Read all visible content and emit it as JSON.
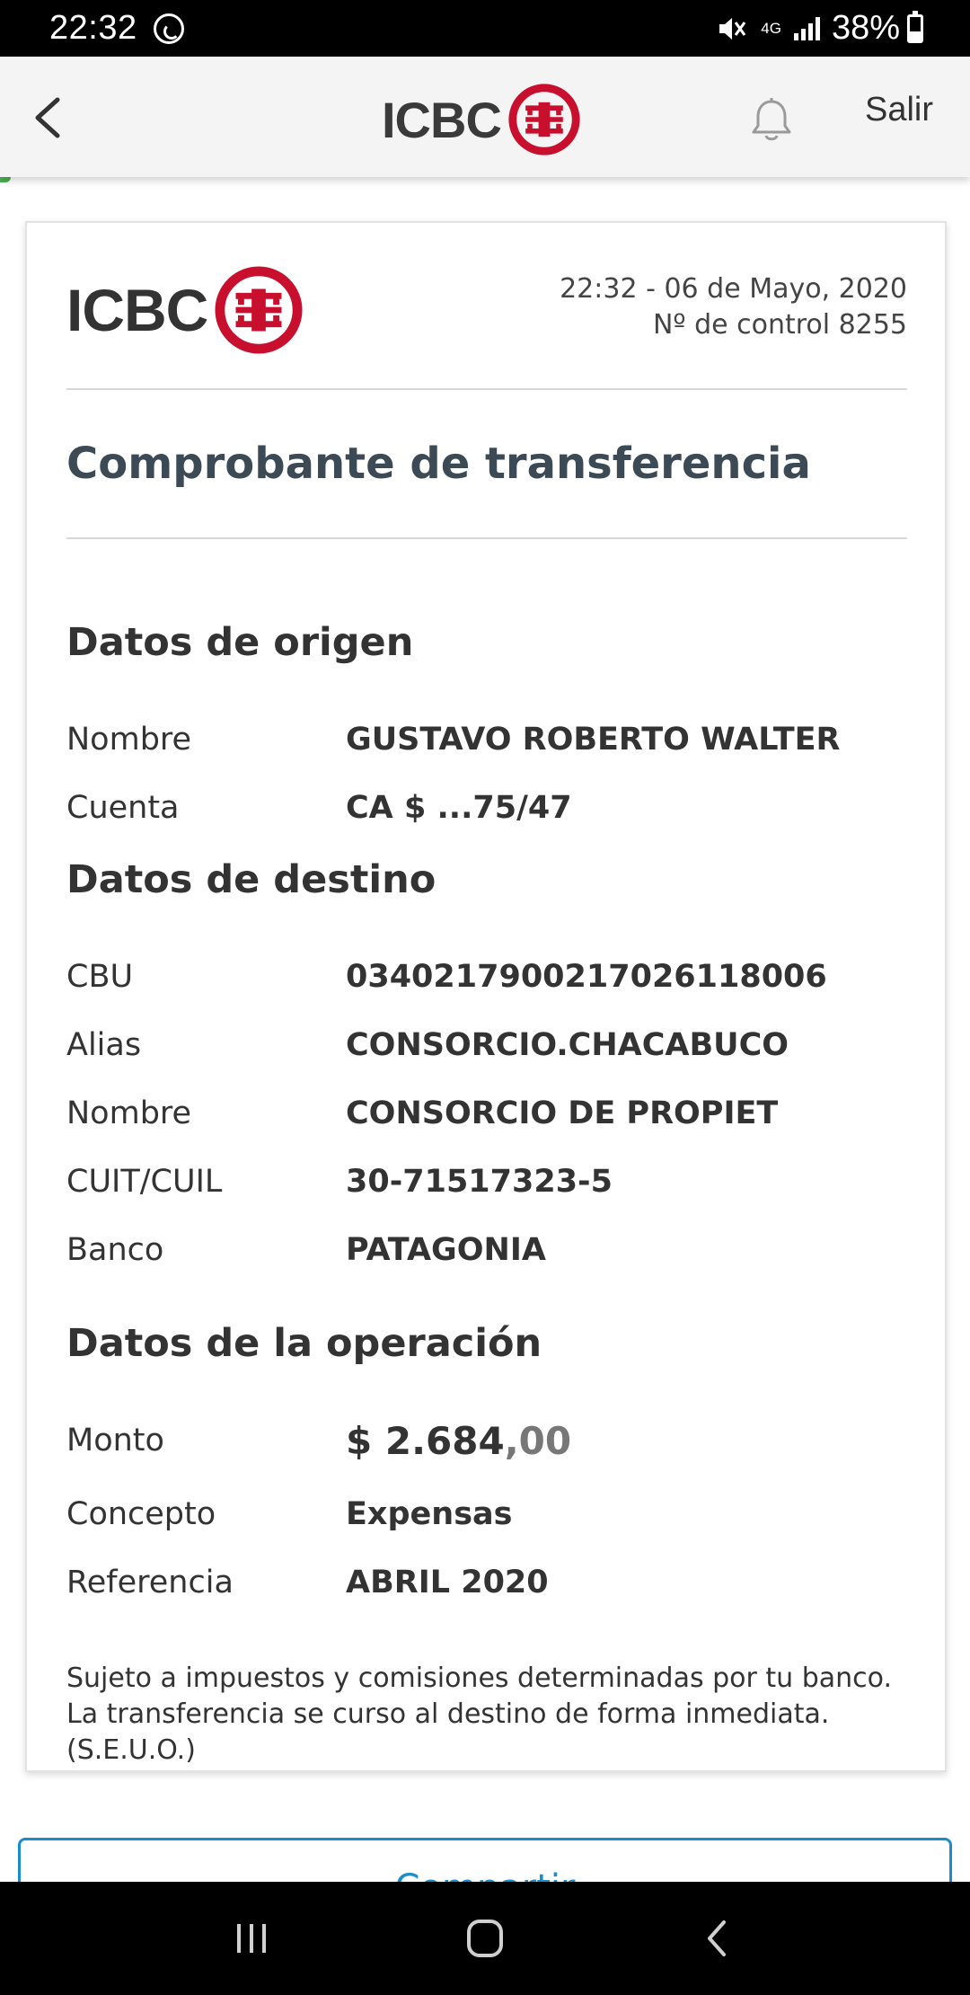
{
  "status_bar": {
    "time": "22:32",
    "network": "4G",
    "battery": "38%"
  },
  "header": {
    "logo_text": "ICBC",
    "logout": "Salir"
  },
  "receipt": {
    "logo_text": "ICBC",
    "datetime": "22:32 - 06 de Mayo, 2020",
    "control": "Nº de control 8255",
    "title": "Comprobante de transferencia",
    "origin": {
      "title": "Datos de origen",
      "rows": [
        {
          "label": "Nombre",
          "value": "GUSTAVO ROBERTO WALTER"
        },
        {
          "label": "Cuenta",
          "value": "CA $ ...75/47"
        }
      ]
    },
    "destination": {
      "title": "Datos de destino",
      "rows": [
        {
          "label": "CBU",
          "value": "0340217900217026118006"
        },
        {
          "label": "Alias",
          "value": "CONSORCIO.CHACABUCO"
        },
        {
          "label": "Nombre",
          "value": "CONSORCIO DE PROPIET"
        },
        {
          "label": "CUIT/CUIL",
          "value": "30-71517323-5"
        },
        {
          "label": "Banco",
          "value": "PATAGONIA"
        }
      ]
    },
    "operation": {
      "title": "Datos de la operación",
      "amount_label": "Monto",
      "amount_main": "$ 2.684",
      "amount_cents": ",00",
      "rows": [
        {
          "label": "Concepto",
          "value": "Expensas"
        },
        {
          "label": "Referencia",
          "value": "ABRIL 2020"
        }
      ]
    },
    "disclaimer": "Sujeto a impuestos y comisiones determinadas por tu banco. La transferencia se curso al destino de forma inmediata. (S.E.U.O.)"
  },
  "share_button": "Compartir",
  "colors": {
    "brand_red": "#c8102e",
    "link_blue": "#1a8ccc"
  }
}
